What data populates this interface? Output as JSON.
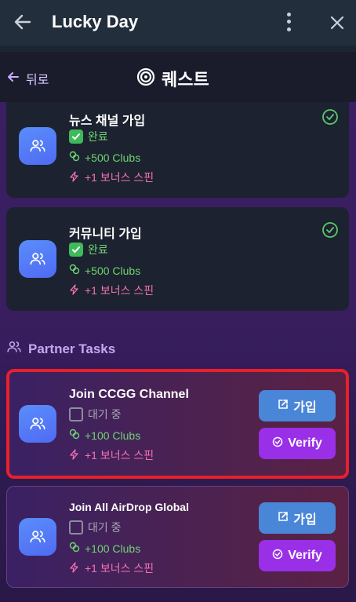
{
  "app": {
    "title": "Lucky Day",
    "back_icon": "arrow-left-icon",
    "menu_icon": "kebab-menu-icon",
    "close_icon": "close-icon"
  },
  "subheader": {
    "back_label": "뒤로",
    "title": "퀘스트",
    "title_icon": "target-icon"
  },
  "completed": [
    {
      "name": "뉴스 채널 가입",
      "status": "완료",
      "reward": "+500 Clubs",
      "bonus": "+1 보너스 스핀"
    },
    {
      "name": "커뮤니티 가입",
      "status": "완료",
      "reward": "+500 Clubs",
      "bonus": "+1 보너스 스핀"
    }
  ],
  "partner_section": {
    "title": "Partner Tasks"
  },
  "partner_tasks": [
    {
      "name": "Join CCGG Channel",
      "status": "대기 중",
      "reward": "+100 Clubs",
      "bonus": "+1 보너스 스핀",
      "join_label": "가입",
      "verify_label": "Verify"
    },
    {
      "name": "Join All AirDrop Global",
      "status": "대기 중",
      "reward": "+100 Clubs",
      "bonus": "+1 보너스 스핀",
      "join_label": "가입",
      "verify_label": "Verify"
    }
  ],
  "colors": {
    "accent": "#9a2fe8",
    "join": "#4a86d8",
    "success": "#3fba5b",
    "bonus": "#f472b6",
    "highlight": "#e8202a"
  }
}
